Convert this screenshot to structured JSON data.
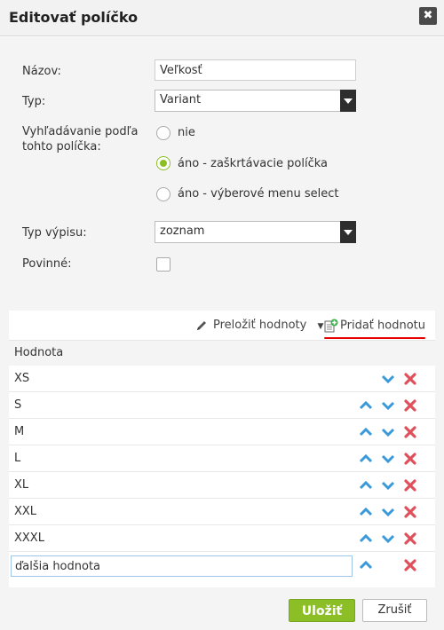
{
  "dialog": {
    "title": "Editovať políčko",
    "close_symbol": "✖"
  },
  "form": {
    "name_label": "Názov:",
    "name_value": "Veľkosť",
    "type_label": "Typ:",
    "type_value": "Variant",
    "search_label_line1": "Vyhľadávanie podľa",
    "search_label_line2": "tohto políčka:",
    "search_options": [
      {
        "label": "nie",
        "checked": false
      },
      {
        "label": "áno - zaškrtávacie políčka",
        "checked": true
      },
      {
        "label": "áno - výberové menu select",
        "checked": false
      }
    ],
    "listing_label": "Typ výpisu:",
    "listing_value": "zoznam",
    "required_label": "Povinné:",
    "required_checked": false
  },
  "values_panel": {
    "translate_label": "Preložiť hodnoty",
    "add_label": "Pridať hodnotu",
    "column_header": "Hodnota",
    "rows": [
      "XS",
      "S",
      "M",
      "L",
      "XL",
      "XXL",
      "XXXL"
    ],
    "new_value": "ďalšia hodnota"
  },
  "footer": {
    "save_label": "Uložiť",
    "cancel_label": "Zrušiť"
  },
  "colors": {
    "accent_green": "#8cbf26",
    "arrow_blue": "#3a9ad9",
    "delete_red": "#e0505a",
    "highlight_red": "#e60000"
  }
}
